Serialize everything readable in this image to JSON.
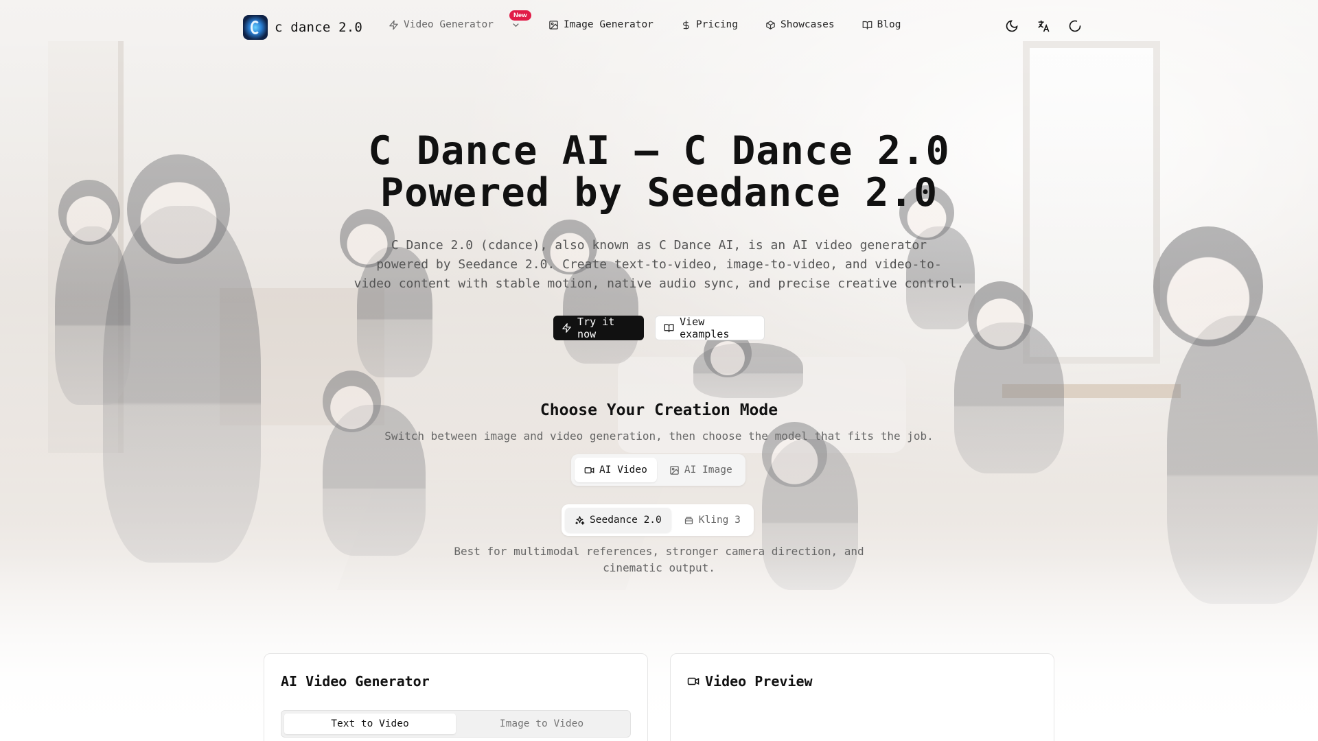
{
  "brand": {
    "name": "c dance 2.0"
  },
  "nav": {
    "items": [
      {
        "label": "Video Generator",
        "icon": "zap-icon",
        "badge": "New"
      },
      {
        "label": "Image Generator",
        "icon": "image-icon"
      },
      {
        "label": "Pricing",
        "icon": "dollar-icon"
      },
      {
        "label": "Showcases",
        "icon": "box-icon"
      },
      {
        "label": "Blog",
        "icon": "book-open-icon"
      }
    ],
    "right_icons": [
      "moon-icon",
      "translate-icon",
      "loading-icon"
    ]
  },
  "hero": {
    "title_line1": "C Dance AI — C Dance 2.0",
    "title_line2": "Powered by Seedance 2.0",
    "subtitle_line1": "C Dance 2.0 (cdance), also known as C Dance AI, is an AI video generator",
    "subtitle_line2": "powered by Seedance 2.0. Create text-to-video, image-to-video, and video-to-",
    "subtitle_line3": "video content with stable motion, native audio sync, and precise creative control.",
    "primary_cta": "Try it now",
    "secondary_cta": "View examples"
  },
  "modes": {
    "title": "Choose Your Creation Mode",
    "subtitle": "Switch between image and video generation, then choose the model that fits the job.",
    "types": [
      {
        "label": "AI Video",
        "icon": "video-icon",
        "active": true
      },
      {
        "label": "AI Image",
        "icon": "image-icon",
        "active": false
      }
    ],
    "models": [
      {
        "label": "Seedance 2.0",
        "icon": "sparkles-icon",
        "active": true
      },
      {
        "label": "Kling 3",
        "icon": "layers-icon",
        "active": false
      }
    ],
    "model_description_line1": "Best for multimodal references, stronger camera direction, and",
    "model_description_line2": "cinematic output."
  },
  "generator": {
    "title": "AI Video Generator",
    "tabs": [
      {
        "label": "Text to Video",
        "active": true
      },
      {
        "label": "Image to Video",
        "active": false
      }
    ]
  },
  "preview": {
    "title": "Video Preview",
    "icon": "video-icon"
  },
  "colors": {
    "primary": "#111111",
    "badge": "#e11d48",
    "muted_text": "#666666"
  }
}
